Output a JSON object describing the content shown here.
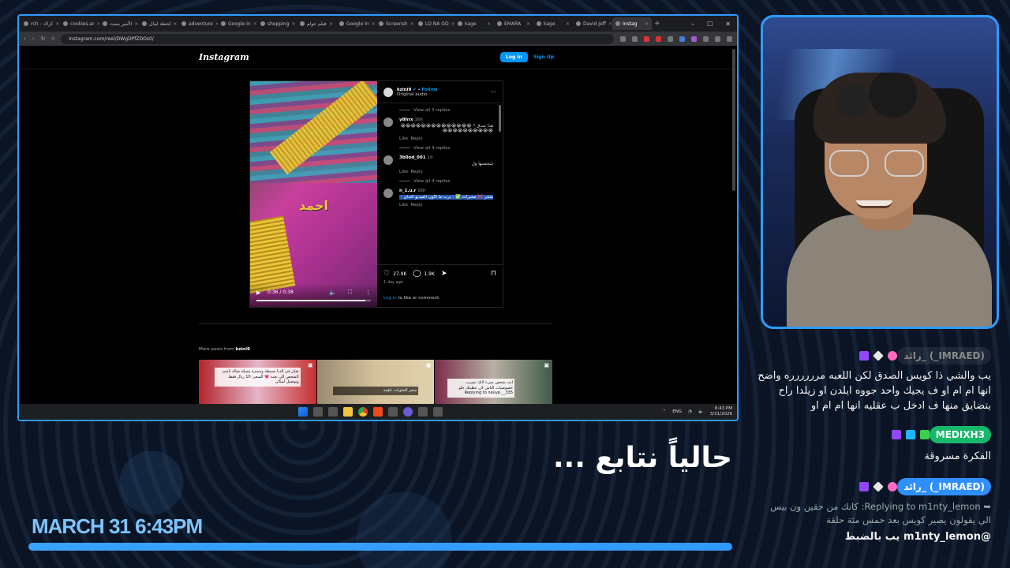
{
  "browser": {
    "tabs": [
      {
        "label": "rch - كراك",
        "active": false
      },
      {
        "label": "cookies.ar",
        "active": false
      },
      {
        "label": "الأمير بست",
        "active": false
      },
      {
        "label": "لحظة لينال",
        "active": false
      },
      {
        "label": "adventure",
        "active": false
      },
      {
        "label": "Google In",
        "active": false
      },
      {
        "label": "shopping",
        "active": false
      },
      {
        "label": "فيلم عوام",
        "active": false
      },
      {
        "label": "Google In",
        "active": false
      },
      {
        "label": "Screensh",
        "active": false
      },
      {
        "label": "LO NA GO",
        "active": false
      },
      {
        "label": "kage",
        "active": false
      },
      {
        "label": "EMARA",
        "active": false
      },
      {
        "label": "kage",
        "active": false
      },
      {
        "label": "David Jeff",
        "active": false
      },
      {
        "label": "Instag",
        "active": true
      }
    ],
    "new_tab": "+",
    "url": "instagram.com/reel/DWgDPfZDOs0/"
  },
  "instagram": {
    "logo": "Instagram",
    "login": "Log in",
    "signup": "Sign Up",
    "video_caption": "احمد",
    "video_time": "0:36 / 0:38",
    "video_progress": 0.95,
    "author": "kzini9",
    "follow": "Follow",
    "audio": "Original audio",
    "view_replies_top": "View all 3 replies",
    "comments": [
      {
        "user": "y8hrx",
        "time": "16h",
        "text": "هذا صدق ؟ 😭😭😭😭😭😭😭😭😭😭😭😭😭😭😭😭😭😭😭😭😭😭😭😭",
        "like": "Like",
        "reply": "Reply",
        "replies": "View all 4 replies",
        "highlight": false
      },
      {
        "user": "3b0od_001",
        "time": "1d",
        "text": "شخصتها ول",
        "like": "Like",
        "reply": "Reply",
        "replies": "View all 4 replies",
        "highlight": false
      },
      {
        "user": "n_1.u.r",
        "time": "16h",
        "text": "متجر ❌ مخيرات ✅ : يرب ما اكون الفيديو الجاي",
        "like": "Like",
        "reply": "Reply",
        "replies": "",
        "highlight": true
      }
    ],
    "likes": "27.9K",
    "comment_count": "1.9K",
    "post_age": "1 day ago",
    "login_prompt_link": "Log in",
    "login_prompt_rest": " to like or comment.",
    "more_posts_prefix": "More posts from ",
    "more_posts_user": "kzini9",
    "thumbs": [
      {
        "text": "تفكر في الدبا بسيطة ومميزة بسيلة صالة باسم الشخص الي تحبه 💗 السعر: 10 ريال فقط وتوصيل لمكان"
      },
      {
        "text": "متجر الحلويات تاهينة"
      },
      {
        "text": "انت شخص سيء لانك تسرب خصوصيات الناس لان عطيتك حلو Replying to neuve.__335"
      }
    ]
  },
  "taskbar": {
    "lang": "ENG",
    "time": "6:43 PM",
    "date": "3/31/2026"
  },
  "chat": [
    {
      "user": "رائد_ (_IMRAED)",
      "text": "يب والشي ذا كويس الصدق لكن اللعبه مرررررره واضح انها ام ام او ف يجيك واحد جووه ايلدن او زيلدا راح يتضايق منها ف ادخل ب عقليه انها ام ام او"
    },
    {
      "user": "MEDIXH3",
      "text": "الفكرة مسروقة"
    },
    {
      "user": "رائد_ (_IMRAED)",
      "text": "➥ Replying to m1nty_lemon: كانك من حقين ون بيس الي يقولون يصير كويس بعد خمس مئة حلقة"
    },
    {
      "text": "@m1nty_lemon يب بالضبط"
    }
  ],
  "overlay": {
    "caption": "حالياً نتابع ...",
    "date": "MARCH 31 6:43PM",
    "stream_progress": 1.0
  },
  "colors": {
    "accent": "#2f9bff",
    "ig_blue": "#0095f6",
    "highlight": "#2c5fb8"
  }
}
